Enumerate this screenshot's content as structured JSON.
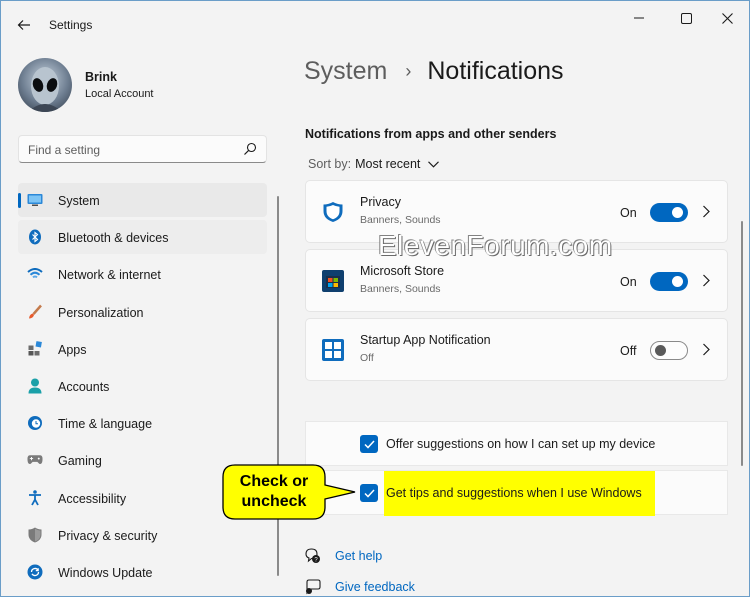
{
  "window": {
    "title": "Settings",
    "controls": {
      "minimize": "minimize",
      "maximize": "maximize",
      "close": "close"
    }
  },
  "profile": {
    "name": "Brink",
    "account_type": "Local Account"
  },
  "search": {
    "placeholder": "Find a setting"
  },
  "sidebar": {
    "items": [
      {
        "label": "System",
        "icon": "system-icon",
        "active": true
      },
      {
        "label": "Bluetooth & devices",
        "icon": "bluetooth-icon"
      },
      {
        "label": "Network & internet",
        "icon": "wifi-icon"
      },
      {
        "label": "Personalization",
        "icon": "brush-icon"
      },
      {
        "label": "Apps",
        "icon": "apps-icon"
      },
      {
        "label": "Accounts",
        "icon": "person-icon"
      },
      {
        "label": "Time & language",
        "icon": "clock-globe-icon"
      },
      {
        "label": "Gaming",
        "icon": "gamepad-icon"
      },
      {
        "label": "Accessibility",
        "icon": "accessibility-icon"
      },
      {
        "label": "Privacy & security",
        "icon": "shield-icon"
      },
      {
        "label": "Windows Update",
        "icon": "update-icon"
      }
    ]
  },
  "breadcrumb": {
    "parent": "System",
    "separator": "›",
    "current": "Notifications"
  },
  "notifications": {
    "section_title": "Notifications from apps and other senders",
    "sort_label": "Sort by:",
    "sort_value": "Most recent",
    "apps": [
      {
        "name": "Privacy",
        "subtitle": "Banners, Sounds",
        "state": "On",
        "enabled": true,
        "icon": "privacy-shield-icon"
      },
      {
        "name": "Microsoft Store",
        "subtitle": "Banners, Sounds",
        "state": "On",
        "enabled": true,
        "icon": "store-icon"
      },
      {
        "name": "Startup App Notification",
        "subtitle": "Off",
        "state": "Off",
        "enabled": false,
        "icon": "startup-app-icon"
      }
    ]
  },
  "suggestions": {
    "offer_label": "Offer suggestions on how I can set up my device",
    "tips_label": "Get tips and suggestions when I use Windows"
  },
  "links": {
    "help": "Get help",
    "feedback": "Give feedback"
  },
  "watermark": "ElevenForum.com",
  "callout": {
    "line1": "Check or",
    "line2": "uncheck"
  },
  "colors": {
    "accent": "#0067c0",
    "highlight": "#ffff00",
    "callout_fill": "#ffff00"
  }
}
